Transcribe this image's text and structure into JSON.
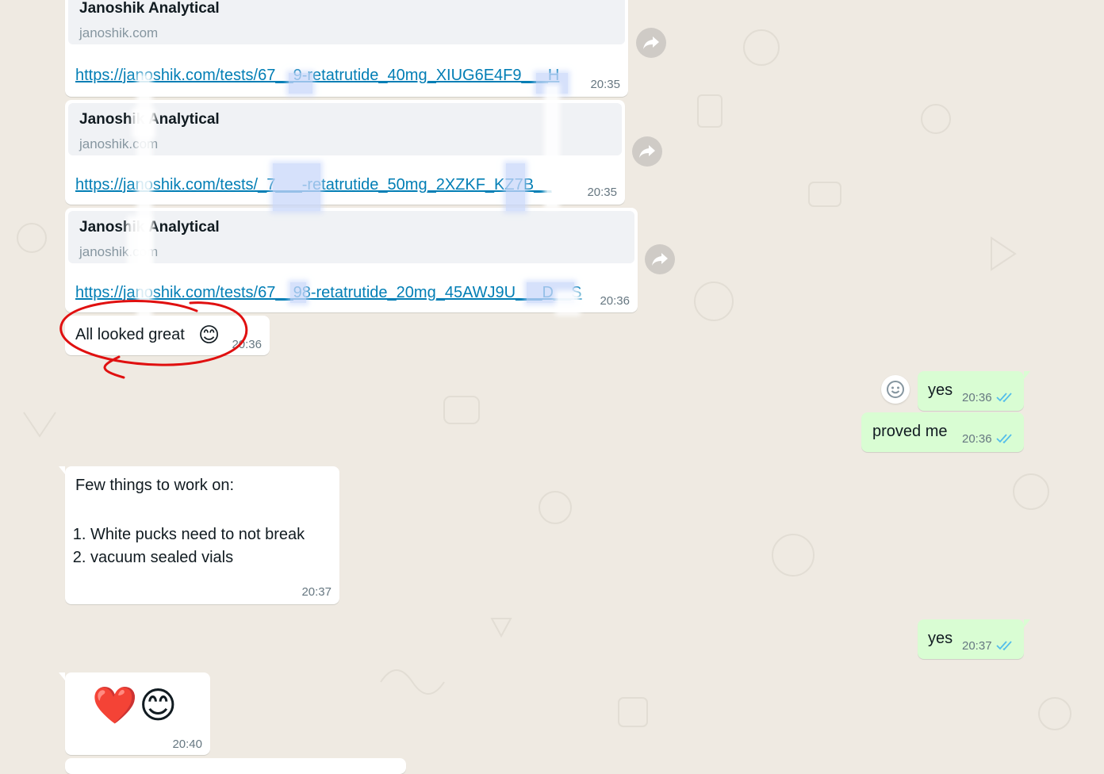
{
  "messages": {
    "link1": {
      "site_title": "Janoshik Analytical",
      "site_domain": "janoshik.com",
      "url": "https://janoshik.com/tests/67__9-retatrutide_40mg_XIUG6E4F9___H",
      "time": "20:35"
    },
    "link2": {
      "site_title": "Janoshik Analytical",
      "site_domain": "janoshik.com",
      "url": "https://janoshik.com/tests/_7___-retatrutide_50mg_2XZKF_KZ7B__",
      "time": "20:35"
    },
    "link3": {
      "site_title": "Janoshik Analytical",
      "site_domain": "janoshik.com",
      "url": "https://janoshik.com/tests/67__98-retatrutide_20mg_45AWJ9U___D__S",
      "time": "20:36"
    },
    "looked_great": {
      "text": "All looked great",
      "emoji": "😊",
      "time": "20:36"
    },
    "out_yes1": {
      "text": "yes",
      "time": "20:36"
    },
    "out_proved": {
      "text": "proved me",
      "time": "20:36"
    },
    "work_on": {
      "heading": "Few things to work on:",
      "items": [
        "White pucks need to not break",
        "vacuum sealed vials"
      ],
      "time": "20:37"
    },
    "out_yes2": {
      "text": "yes",
      "time": "20:37"
    },
    "emoji_msg": {
      "emojis": "❤️😊",
      "time": "20:40"
    }
  },
  "colors": {
    "background": "#efeae2",
    "incoming": "#ffffff",
    "outgoing": "#d9fdd3",
    "link": "#027eb5",
    "read_ticks": "#53bdeb",
    "annotation": "#e01010"
  },
  "icons": {
    "forward": "forward-arrow-icon",
    "react": "emoji-react-icon",
    "read": "double-check-icon"
  }
}
